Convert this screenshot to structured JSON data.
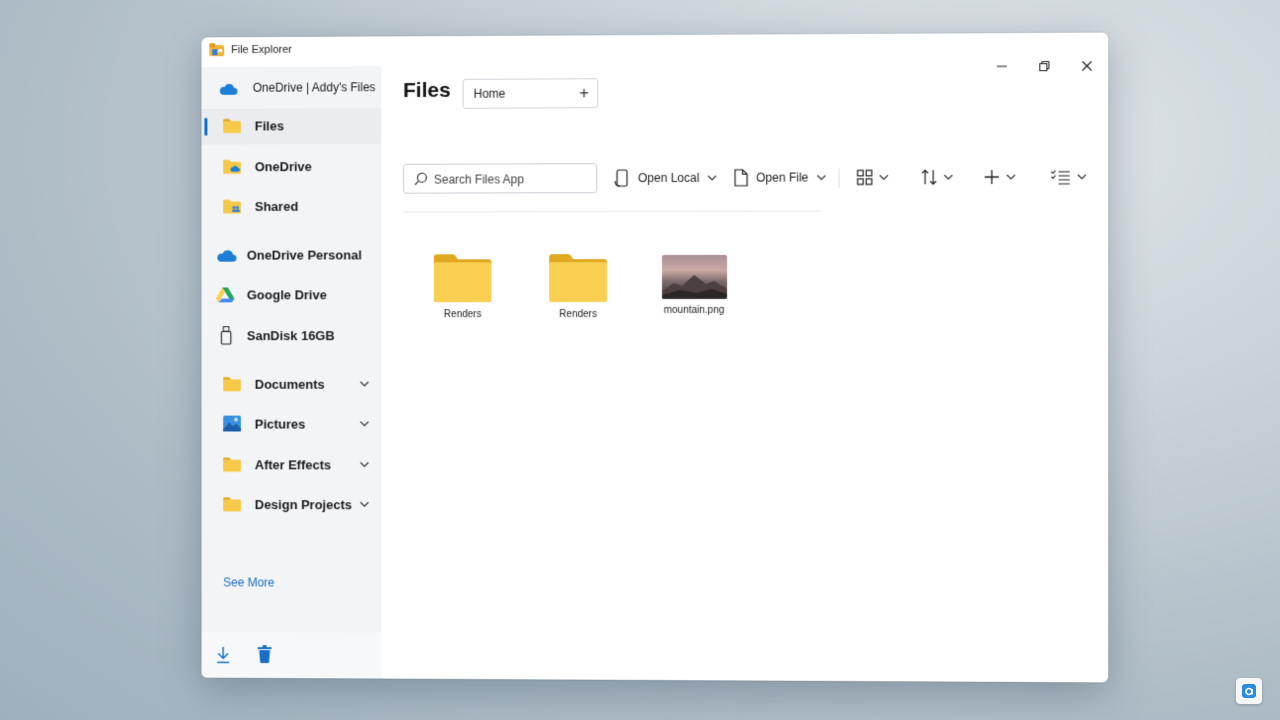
{
  "window": {
    "title": "File Explorer"
  },
  "sidebar": {
    "account": "OneDrive | Addy's Files",
    "items": [
      {
        "label": "Files",
        "icon": "folder-icon",
        "selected": true
      },
      {
        "label": "OneDrive",
        "icon": "onedrive-folder-icon"
      },
      {
        "label": "Shared",
        "icon": "shared-folder-icon"
      }
    ],
    "locations": [
      {
        "label": "OneDrive Personal",
        "icon": "onedrive-cloud-icon"
      },
      {
        "label": "Google Drive",
        "icon": "google-drive-icon"
      },
      {
        "label": "SanDisk 16GB",
        "icon": "usb-drive-icon"
      }
    ],
    "folders": [
      {
        "label": "Documents",
        "icon": "folder-icon"
      },
      {
        "label": "Pictures",
        "icon": "pictures-folder-icon"
      },
      {
        "label": "After Effects",
        "icon": "folder-icon"
      },
      {
        "label": "Design Projects",
        "icon": "folder-icon"
      }
    ],
    "see_more": "See More"
  },
  "main": {
    "title": "Files",
    "tab": {
      "label": "Home"
    },
    "search": {
      "placeholder": "Search Files App"
    },
    "toolbar": {
      "open_local": "Open Local",
      "open_file": "Open File"
    },
    "files": [
      {
        "name": "Renders",
        "type": "folder"
      },
      {
        "name": "Renders",
        "type": "folder"
      },
      {
        "name": "mountain.png",
        "type": "image"
      }
    ]
  },
  "colors": {
    "accent": "#0a6ed1",
    "folder": "#f7c948",
    "folder_dark": "#e0a820"
  }
}
